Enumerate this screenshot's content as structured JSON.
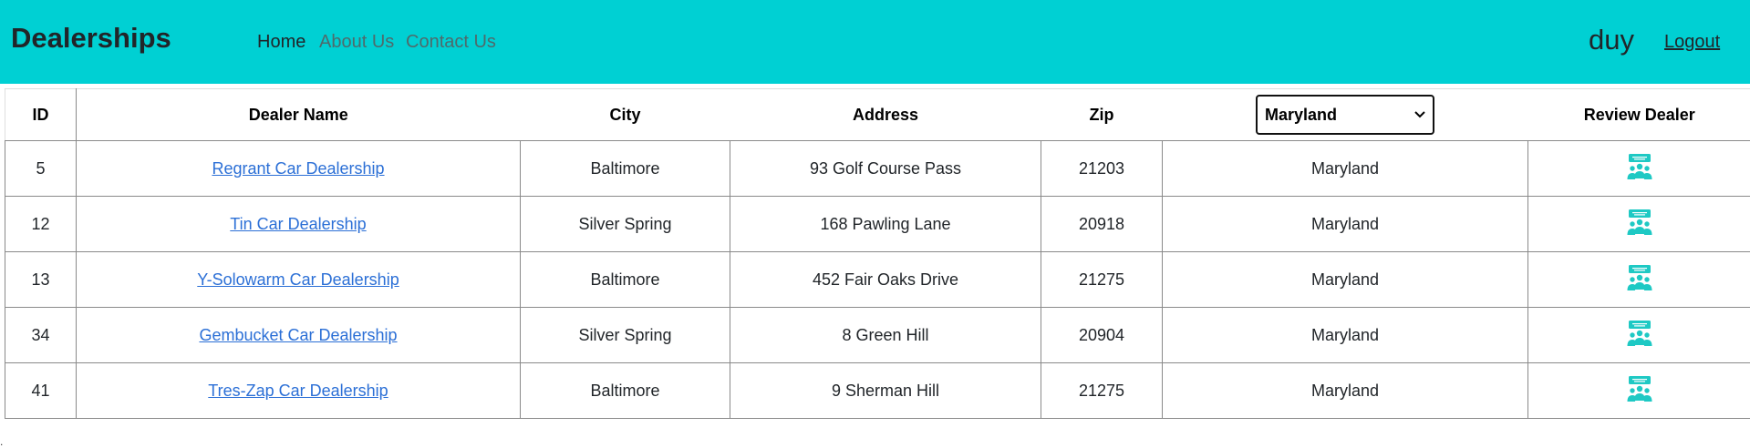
{
  "navbar": {
    "brand": "Dealerships",
    "links": [
      "Home",
      "About Us",
      "Contact Us"
    ],
    "username": "duy",
    "logout": "Logout",
    "bg_color": "#00d0d3"
  },
  "table": {
    "headers": {
      "id": "ID",
      "dealer_name": "Dealer Name",
      "city": "City",
      "address": "Address",
      "zip": "Zip",
      "review": "Review Dealer"
    },
    "state_filter": {
      "selected": "Maryland"
    },
    "rows": [
      {
        "id": "5",
        "name": "Regrant Car Dealership",
        "city": "Baltimore",
        "address": "93 Golf Course Pass",
        "zip": "21203",
        "state": "Maryland"
      },
      {
        "id": "12",
        "name": "Tin Car Dealership",
        "city": "Silver Spring",
        "address": "168 Pawling Lane",
        "zip": "20918",
        "state": "Maryland"
      },
      {
        "id": "13",
        "name": "Y-Solowarm Car Dealership",
        "city": "Baltimore",
        "address": "452 Fair Oaks Drive",
        "zip": "21275",
        "state": "Maryland"
      },
      {
        "id": "34",
        "name": "Gembucket Car Dealership",
        "city": "Silver Spring",
        "address": "8 Green Hill",
        "zip": "20904",
        "state": "Maryland"
      },
      {
        "id": "41",
        "name": "Tres-Zap Car Dealership",
        "city": "Baltimore",
        "address": "9 Sherman Hill",
        "zip": "21275",
        "state": "Maryland"
      }
    ],
    "review_icon": "review-people-icon",
    "link_color": "#2b6fd6",
    "icon_color": "#1ec9c4"
  },
  "footer_mark": "."
}
